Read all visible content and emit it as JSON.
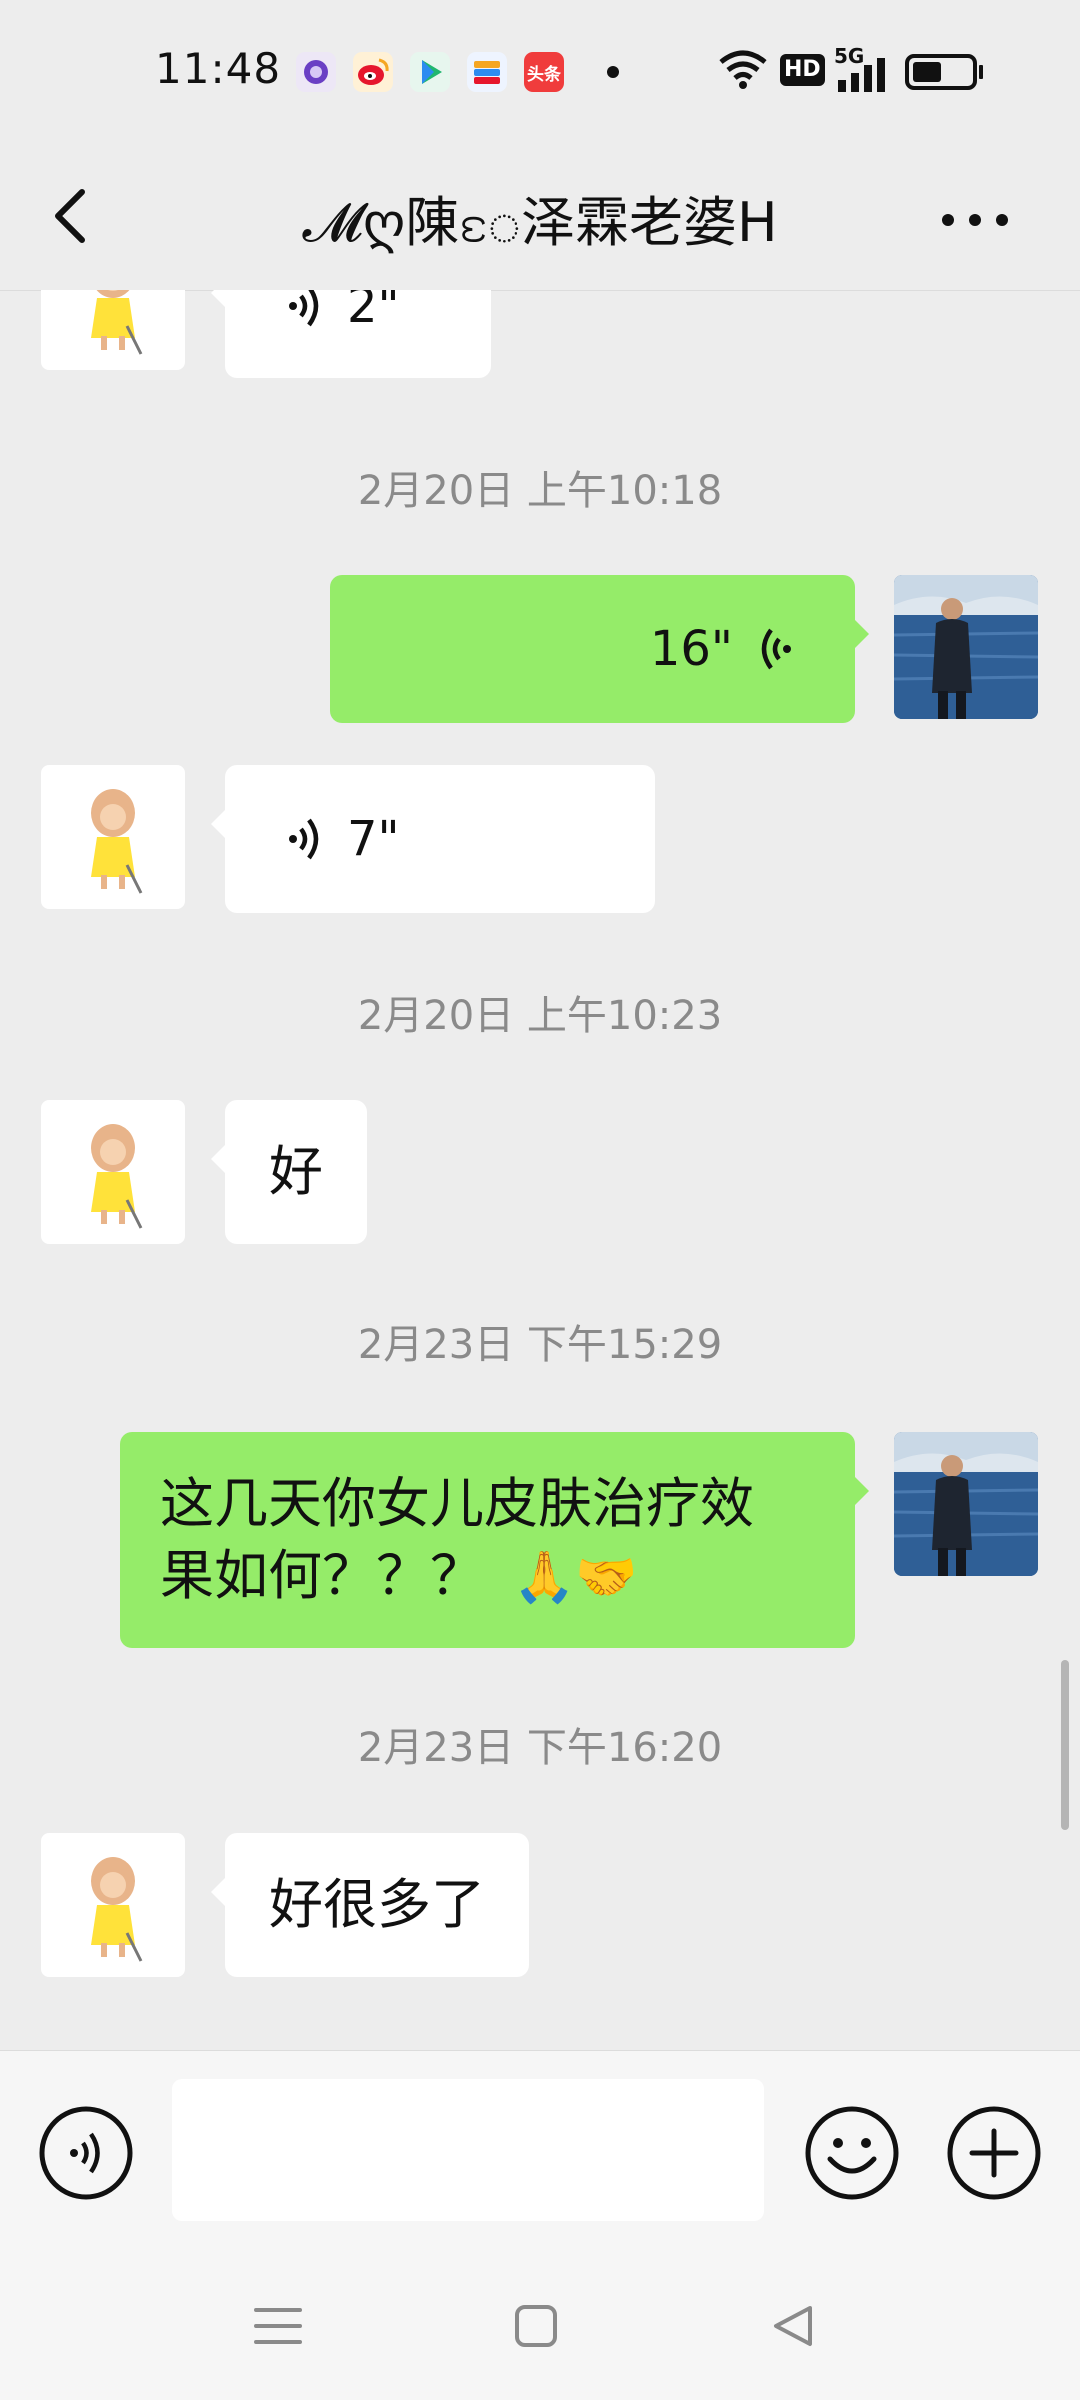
{
  "status_bar": {
    "time": "11:48",
    "notification_icons": [
      "podcast-app-icon",
      "weibo-icon",
      "video-app-icon",
      "wallet-app-icon",
      "toutiao-icon"
    ],
    "toutiao_label": "头条",
    "hd_label": "HD",
    "network_label": "5G",
    "battery_level": 0.5
  },
  "nav": {
    "title": "𝓜ღ陳ႄ泽霖老婆H",
    "back_icon": "chevron-left-icon",
    "more_icon": "more-dots-icon"
  },
  "messages": [
    {
      "kind": "voice",
      "direction": "in",
      "duration": "2\""
    },
    {
      "kind": "timestamp",
      "text": "2月20日 上午10:18"
    },
    {
      "kind": "voice",
      "direction": "out",
      "duration": "16\""
    },
    {
      "kind": "voice",
      "direction": "in",
      "duration": "7\""
    },
    {
      "kind": "timestamp",
      "text": "2月20日 上午10:23"
    },
    {
      "kind": "text",
      "direction": "in",
      "text": "好"
    },
    {
      "kind": "timestamp",
      "text": "2月23日 下午15:29"
    },
    {
      "kind": "text",
      "direction": "out",
      "line1": "这几天你女儿皮肤治疗效",
      "line2": "果如何？？？",
      "emoji": "🙏🤝"
    },
    {
      "kind": "timestamp",
      "text": "2月23日 下午16:20"
    },
    {
      "kind": "text",
      "direction": "in",
      "text": "好很多了"
    }
  ],
  "input_bar": {
    "voice_button_icon": "voice-mode-icon",
    "input_value": "",
    "emoji_button_icon": "emoji-smile-icon",
    "plus_button_icon": "plus-circle-icon"
  },
  "system_nav": {
    "menu_icon": "menu-lines-icon",
    "home_icon": "home-square-icon",
    "back_icon": "back-triangle-icon"
  },
  "colors": {
    "background": "#ededed",
    "outgoing_bubble": "#95ec69",
    "incoming_bubble": "#ffffff",
    "timestamp_text": "#8a8a8a"
  }
}
